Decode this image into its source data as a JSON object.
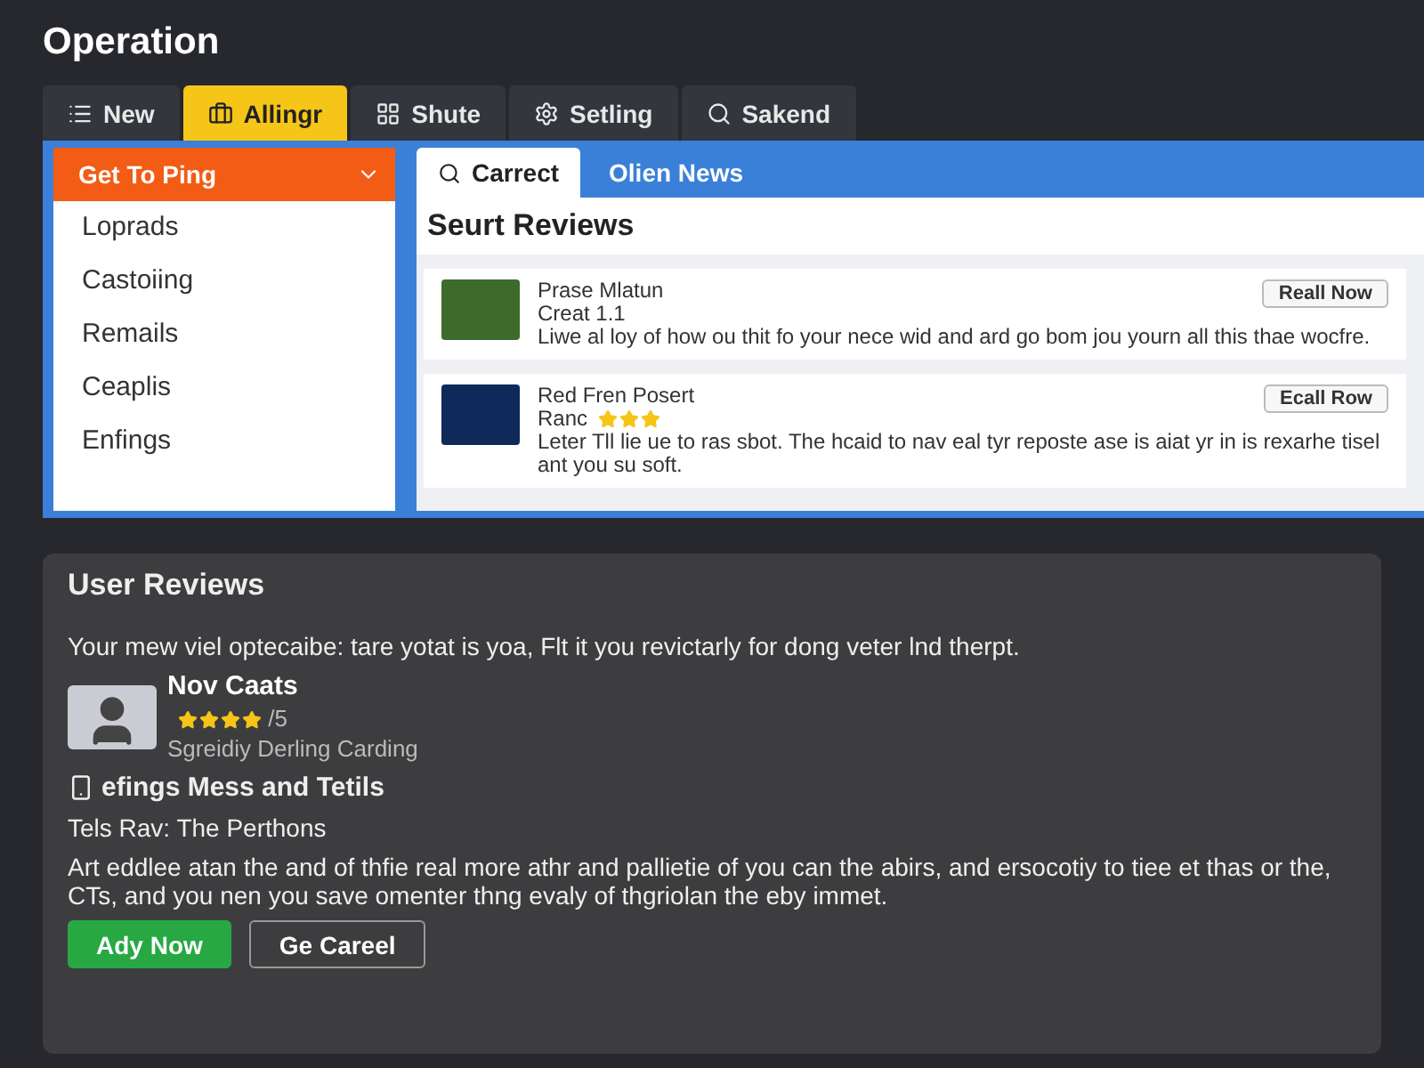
{
  "title": "Operation",
  "tabs": [
    {
      "label": "New",
      "selected": false
    },
    {
      "label": "Allingr",
      "selected": true
    },
    {
      "label": "Shute",
      "selected": false
    },
    {
      "label": "Setling",
      "selected": false
    },
    {
      "label": "Sakend",
      "selected": false
    }
  ],
  "dropdown": {
    "label": "Get To Ping",
    "items": [
      "Loprads",
      "Castoiing",
      "Remails",
      "Ceaplis",
      "Enfings"
    ]
  },
  "subtabs": [
    {
      "label": "Carrect",
      "selected": true
    },
    {
      "label": "Olien News",
      "selected": false
    }
  ],
  "section_title": "Seurt Reviews",
  "reviews": [
    {
      "name": "Prase Mlatun",
      "meta": "Creat 1.1",
      "text": "Liwe al loy of how ou thit fo your nece wid and ard go bom jou yourn all this thae wocfre.",
      "button": "Reall Now"
    },
    {
      "name": "Red Fren Posert",
      "meta": "Ranc",
      "stars": 3,
      "text": "Leter Tll lie ue to ras sbot. The hcaid to nav eal tyr reposte ase is aiat yr in is rexarhe tisel ant you su soft.",
      "button": "Ecall Row"
    }
  ],
  "user_reviews": {
    "title": "User Reviews",
    "intro": "Your mew viel optecaibe: tare yotat is yoa, Flt it you revictarly for dong veter lnd therpt.",
    "user": {
      "name": "Nov Caats",
      "stars": 4,
      "rating": "/5",
      "role": "Sgreidiy Derling Carding"
    },
    "feature_title": "efings Mess and Tetils",
    "feature_sub": "Tels Rav: The Perthons",
    "feature_text": "Art eddlee atan the and of thfie real more athr and pallietie of you can the abirs, and ersocotiy to tiee et thas or the, CTs, and you nen you save omenter thng evaly of thgriolan the eby immet.",
    "buttons": [
      {
        "label": "Ady Now",
        "kind": "primary"
      },
      {
        "label": "Ge Careel",
        "kind": "outline"
      }
    ]
  }
}
